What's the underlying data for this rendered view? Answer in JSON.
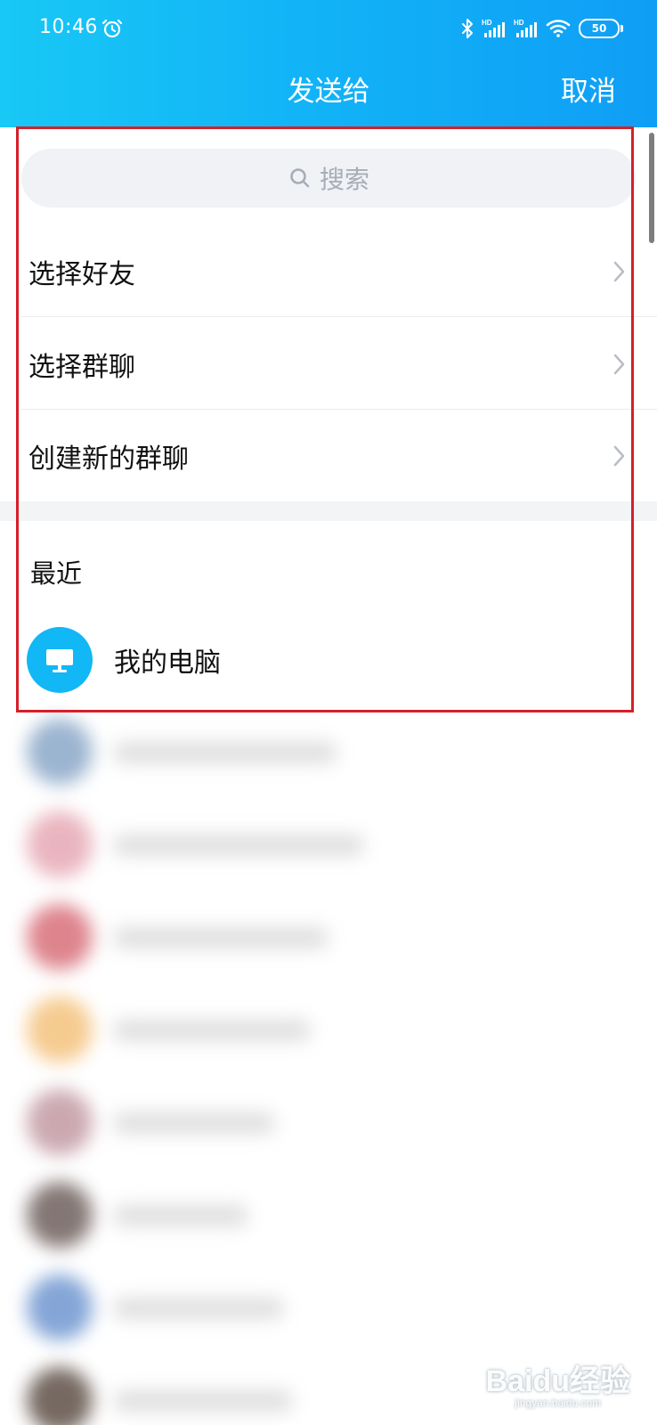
{
  "status_bar": {
    "time": "10:46",
    "hd_label": "HD",
    "battery": "50"
  },
  "header": {
    "title": "发送给",
    "cancel_label": "取消"
  },
  "search": {
    "placeholder": "搜索"
  },
  "menu": {
    "items": [
      {
        "label": "选择好友"
      },
      {
        "label": "选择群聊"
      },
      {
        "label": "创建新的群聊"
      }
    ]
  },
  "recent": {
    "section_label": "最近",
    "contacts": [
      {
        "name": "我的电脑",
        "icon": "monitor-icon"
      }
    ]
  },
  "colors": {
    "header_start": "#18c8f5",
    "header_end": "#0f9ef5",
    "accent": "#12b7f5",
    "highlight_frame": "#d61f29"
  },
  "watermark": {
    "main": "Baidu经验",
    "sub": "jingyan.baidu.com"
  }
}
